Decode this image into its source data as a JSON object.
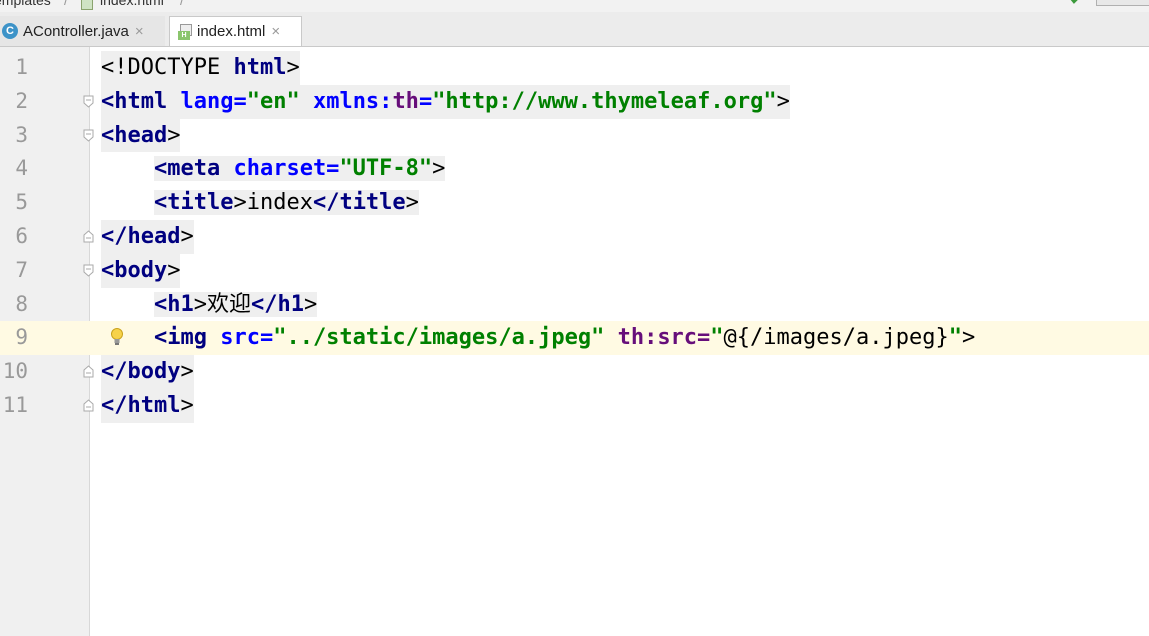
{
  "breadcrumb": {
    "segment1": "emplates",
    "segment2": "index.html"
  },
  "tabs": [
    {
      "label": "AController.java",
      "icon": "java-class-icon",
      "close": "×",
      "active": false
    },
    {
      "label": "index.html",
      "icon": "html-file-icon",
      "close": "×",
      "active": true
    }
  ],
  "editor": {
    "current_line": 9,
    "lines": [
      {
        "num": "1"
      },
      {
        "num": "2"
      },
      {
        "num": "3"
      },
      {
        "num": "4"
      },
      {
        "num": "5"
      },
      {
        "num": "6"
      },
      {
        "num": "7"
      },
      {
        "num": "8"
      },
      {
        "num": "9"
      },
      {
        "num": "10"
      },
      {
        "num": "11"
      }
    ],
    "tokens": {
      "l1_a": "<!DOCTYPE ",
      "l1_b": "html",
      "l1_c": ">",
      "l2_a": "<html ",
      "l2_b": "lang=",
      "l2_c": "\"en\" ",
      "l2_d": "xmlns:",
      "l2_e": "th",
      "l2_f": "=",
      "l2_g": "\"http://www.thymeleaf.org\"",
      "l2_h": ">",
      "l3_a": "<head",
      "l3_b": ">",
      "l4_a": "<meta ",
      "l4_b": "charset=",
      "l4_c": "\"UTF-8\"",
      "l4_d": ">",
      "l5_a": "<title",
      "l5_b": ">",
      "l5_c": "index",
      "l5_d": "</title",
      "l5_e": ">",
      "l6_a": "</head",
      "l6_b": ">",
      "l7_a": "<body",
      "l7_b": ">",
      "l8_a": "<h1",
      "l8_b": ">",
      "l8_c": "欢迎",
      "l8_d": "</h1",
      "l8_e": ">",
      "l9_a": "<img ",
      "l9_b": "src=",
      "l9_c": "\"../static/images/a.jpeg\" ",
      "l9_d": "th:src=",
      "l9_e": "\"",
      "l9_f": "@{/images/a.jpeg}",
      "l9_g": "\"",
      "l9_h": ">",
      "l10_a": "</body",
      "l10_b": ">",
      "l11_a": "</html",
      "l11_b": ">"
    }
  },
  "colors": {
    "tag": "#000080",
    "attribute": "#0000ff",
    "value": "#008000",
    "namespace": "#660e7a",
    "current_line": "#fffae3",
    "gutter": "#f0f0f0"
  }
}
